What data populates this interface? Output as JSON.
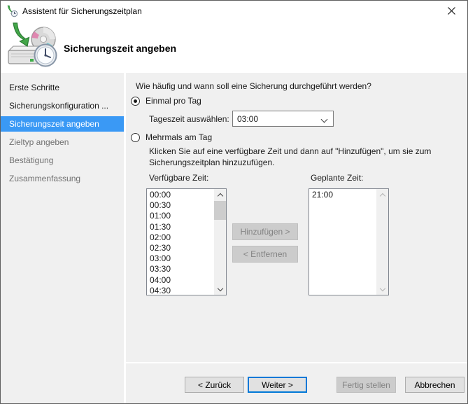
{
  "window": {
    "title": "Assistent für Sicherungszeitplan"
  },
  "header": {
    "title": "Sicherungszeit angeben"
  },
  "sidebar": {
    "items": [
      {
        "label": "Erste Schritte",
        "state": "done"
      },
      {
        "label": "Sicherungskonfiguration ...",
        "state": "done"
      },
      {
        "label": "Sicherungszeit angeben",
        "state": "active"
      },
      {
        "label": "Zieltyp angeben",
        "state": "pending"
      },
      {
        "label": "Bestätigung",
        "state": "pending"
      },
      {
        "label": "Zusammenfassung",
        "state": "pending"
      }
    ]
  },
  "content": {
    "question": "Wie häufig und wann soll eine Sicherung durchgeführt werden?",
    "option_once": {
      "label": "Einmal pro Tag",
      "selected": true
    },
    "time_select": {
      "label": "Tageszeit auswählen:",
      "value": "03:00"
    },
    "option_multiple": {
      "label": "Mehrmals am Tag",
      "selected": false
    },
    "instruction_line1": "Klicken Sie auf eine verfügbare Zeit und dann auf \"Hinzufügen\", um sie zum",
    "instruction_line2": "Sicherungszeitplan hinzuzufügen.",
    "available_label": "Verfügbare Zeit:",
    "scheduled_label": "Geplante Zeit:",
    "available_times": [
      "00:00",
      "00:30",
      "01:00",
      "01:30",
      "02:00",
      "02:30",
      "03:00",
      "03:30",
      "04:00",
      "04:30"
    ],
    "scheduled_times": [
      "21:00"
    ],
    "add_button": "Hinzufügen >",
    "remove_button": "< Entfernen"
  },
  "footer": {
    "back": "< Zurück",
    "next": "Weiter >",
    "finish": "Fertig stellen",
    "cancel": "Abbrechen"
  },
  "colors": {
    "accent_default_button_border": "#0078d7",
    "sidebar_selection": "#3a99f5",
    "disabled_button_bg": "#cccccc",
    "disabled_text": "#838383",
    "header_bg": "#ffffff",
    "body_bg": "#f0f0f0"
  }
}
